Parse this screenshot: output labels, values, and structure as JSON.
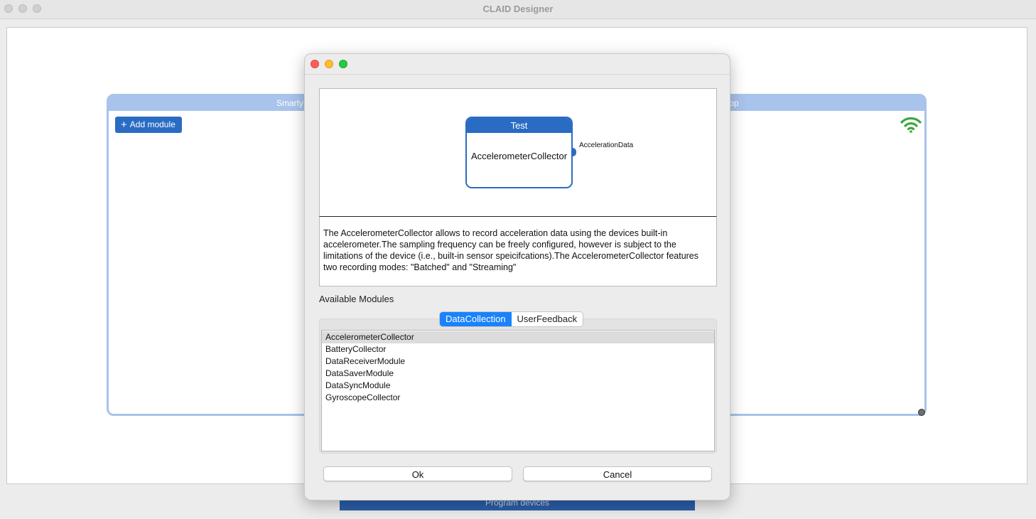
{
  "window": {
    "title": "CLAID Designer"
  },
  "device": {
    "left_name": "Smarty",
    "right_name": "top",
    "add_module_label": "Add module",
    "wifi_color": "#3aa63c"
  },
  "program_devices_label": "Program devices",
  "dialog": {
    "module_preview": {
      "header": "Test",
      "name": "AccelerometerCollector",
      "output_port": "AccelerationData",
      "accent_color": "#2a6cc4"
    },
    "description": "The AccelerometerCollector allows to record acceleration data using the devices built-in accelerometer.The sampling frequency can be freely configured, however is subject to the limitations of the device (i.e., built-in sensor speicifcations).The AccelerometerCollector features two recording modes: \"Batched\" and \"Streaming\"",
    "available_modules_label": "Available Modules",
    "tabs": [
      {
        "label": "DataCollection",
        "active": true
      },
      {
        "label": "UserFeedback",
        "active": false
      }
    ],
    "modules": [
      "AccelerometerCollector",
      "BatteryCollector",
      "DataReceiverModule",
      "DataSaverModule",
      "DataSyncModule",
      "GyroscopeCollector"
    ],
    "selected_module_index": 0,
    "ok_label": "Ok",
    "cancel_label": "Cancel"
  }
}
